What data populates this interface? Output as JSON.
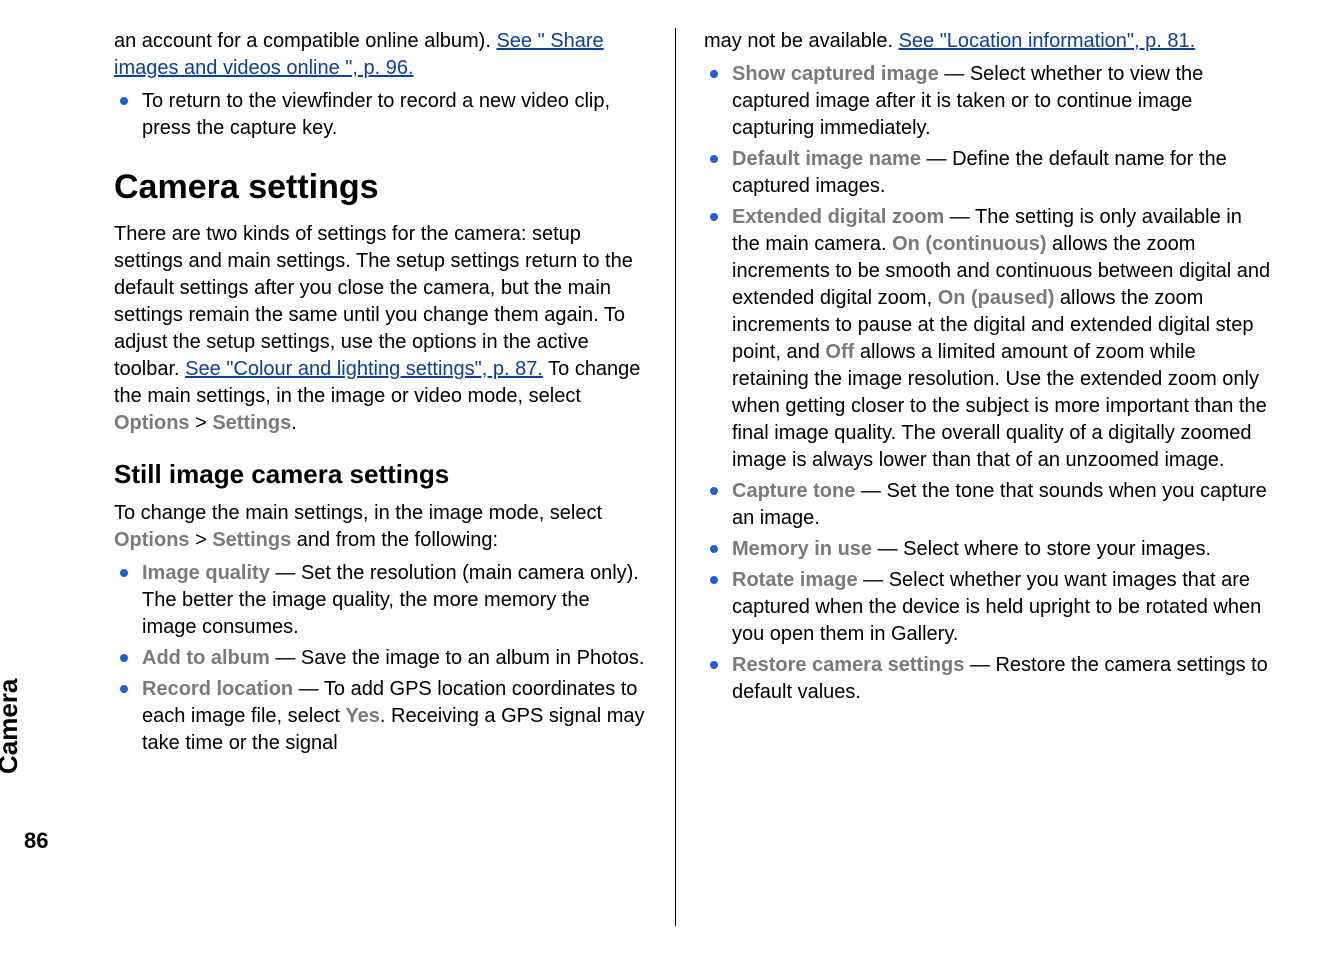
{
  "side_tab": "Camera",
  "page_number": "86",
  "mdash": " — ",
  "gt": " > ",
  "left": {
    "top_para_pre": "an account for a compatible online album). ",
    "top_link": "See \" Share images and videos online \", p. 96.",
    "bul_return": "To return to the viewfinder to record a new video clip, press the capture key.",
    "h1": "Camera settings",
    "intro_a": "There are two kinds of settings for the camera: setup settings and main settings. The setup settings return to the default settings after you close the camera, but the main settings remain the same until you change them again. To adjust the setup settings, use the options in the active toolbar. ",
    "intro_link": "See \"Colour and lighting settings\", p. 87.",
    "intro_b_pre": " To change the main settings, in the image or video mode, select ",
    "options": "Options",
    "settings": "Settings",
    "period": ".",
    "h2": "Still image camera settings",
    "change_pre": "To change the main settings, in the image mode, select ",
    "change_post": " and from the following:",
    "iq_label": "Image quality",
    "iq_text": "Set the resolution (main camera only). The better the image quality, the more memory the image consumes.",
    "album_label": "Add to album",
    "album_text": "Save the image to an album in Photos.",
    "rec_label": "Record location",
    "rec_text_a": "To add GPS location coordinates to each image file, select ",
    "yes": "Yes",
    "rec_text_b": ". Receiving a GPS signal may take time or the signal"
  },
  "right": {
    "top_a": "may not be available. ",
    "top_link": "See \"Location information\", p. 81.",
    "show_label": "Show captured image",
    "show_text": "Select whether to view the captured image after it is taken or to continue image capturing immediately.",
    "defname_label": "Default image name",
    "defname_text": "Define the default name for the captured images.",
    "ext_label": "Extended digital zoom",
    "ext_a": "The setting is only available in the main camera. ",
    "on_cont": "On (continuous)",
    "ext_b": " allows the zoom increments to be smooth and continuous between digital and extended digital zoom, ",
    "on_paused": "On (paused)",
    "ext_c": " allows the zoom increments to pause at the digital and extended digital step point, and ",
    "off": "Off",
    "ext_d": " allows a limited amount of zoom while retaining the image resolution. Use the extended zoom only when getting closer to the subject is more important than the final image quality. The overall quality of a digitally zoomed image is always lower than that of an unzoomed image.",
    "tone_label": "Capture tone",
    "tone_text": "Set the tone that sounds when you capture an image.",
    "mem_label": "Memory in use",
    "mem_text": "Select where to store your images.",
    "rot_label": "Rotate image",
    "rot_text": "Select whether you want images that are captured when the device is held upright to be rotated when you open them in Gallery.",
    "rest_label": "Restore camera settings",
    "rest_text": "Restore the camera settings to default values."
  }
}
